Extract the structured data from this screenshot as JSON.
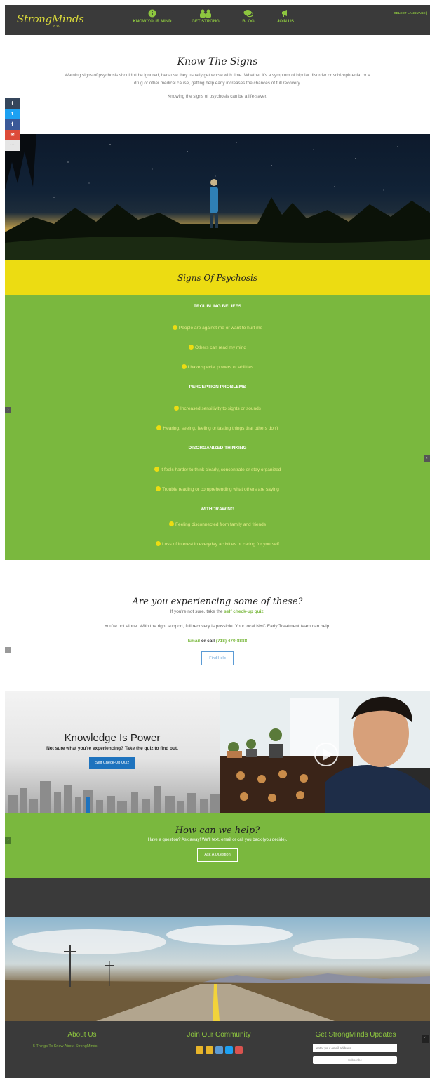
{
  "nav": {
    "logo": "StrongMinds",
    "logo_sub": "NYC",
    "items": [
      {
        "label": "KNOW YOUR MIND",
        "icon": "info-circle-icon"
      },
      {
        "label": "GET STRONG",
        "icon": "people-icon"
      },
      {
        "label": "BLOG",
        "icon": "chat-icon"
      },
      {
        "label": "JOIN US",
        "icon": "megaphone-icon"
      }
    ],
    "language": "SELECT LANGUAGE |"
  },
  "share": [
    {
      "label": "t",
      "icon": "tumblr-icon",
      "color": "#35465c"
    },
    {
      "label": "t",
      "icon": "twitter-icon",
      "color": "#1da1f2"
    },
    {
      "label": "f",
      "icon": "facebook-icon",
      "color": "#3b5998"
    },
    {
      "label": "✉",
      "icon": "email-icon",
      "color": "#dd4b39"
    },
    {
      "label": "···",
      "icon": "more-icon",
      "color": "#e5e5e5"
    }
  ],
  "intro": {
    "title": "Know The Signs",
    "para1": "Warning signs of psychosis shouldn't be ignored, because they usually get worse with time. Whether it's a symptom of bipolar disorder or schizophrenia, or a drug or other medical cause, getting help early increases the chances of full recovery.",
    "para2": "Knowing the signs of psychosis can be a life-saver."
  },
  "signs": {
    "title": "Signs Of Psychosis",
    "categories": [
      {
        "name": "TROUBLING BELIEFS",
        "items": [
          "People are against me or want to hurt me",
          "Others can read my mind",
          "I have special powers or abilities"
        ]
      },
      {
        "name": "PERCEPTION PROBLEMS",
        "items": [
          "Increased sensitivity to sights or sounds",
          "Hearing, seeing, feeling or tasting things that others don't"
        ]
      },
      {
        "name": "DISORGANIZED THINKING",
        "items": [
          "It feels harder to think clearly, concentrate or stay organized",
          "Trouble reading or comprehending what others are saying"
        ]
      },
      {
        "name": "WITHDRAWING",
        "items": [
          "Feeling disconnected from family and friends",
          "Loss of interest in everyday activities or caring for yourself"
        ]
      }
    ]
  },
  "experiencing": {
    "title": "Are you experiencing some of these?",
    "quiz_prefix": "If you're not sure, take the ",
    "quiz_link": "self check-up quiz.",
    "support": "You're not alone. With the right support, full recovery is possible. Your local NYC Early Treatment team can help.",
    "email": "Email",
    "or_call": " or call ",
    "phone": "(718) 470-8888",
    "button": "Find Help"
  },
  "knowledge": {
    "title": "Knowledge Is Power",
    "subtitle": "Not sure what you're experiencing? Take the quiz to find out.",
    "button": "Self Check-Up Quiz"
  },
  "help": {
    "title": "How can we help?",
    "text": "Have a question? Ask away! We'll text, email or call you back (you decide).",
    "button": "Ask A Question"
  },
  "footer": {
    "about_title": "About Us",
    "about_link": "5 Things To Know About StrongMinds",
    "community_title": "Join Our Community",
    "social": [
      {
        "icon": "email-icon",
        "color": "#e8b52a"
      },
      {
        "icon": "tumblr-icon",
        "color": "#e8b52a"
      },
      {
        "icon": "instagram-icon",
        "color": "#5b9bd5"
      },
      {
        "icon": "twitter-icon",
        "color": "#1da1f2"
      },
      {
        "icon": "youtube-icon",
        "color": "#d9534f"
      }
    ],
    "updates_title": "Get StrongMinds Updates",
    "email_placeholder": "enter your email address",
    "subscribe": "Subscribe"
  },
  "colors": {
    "brand_green": "#7ab83e",
    "brand_yellow": "#ecdc12",
    "dark": "#3a3a3a"
  }
}
